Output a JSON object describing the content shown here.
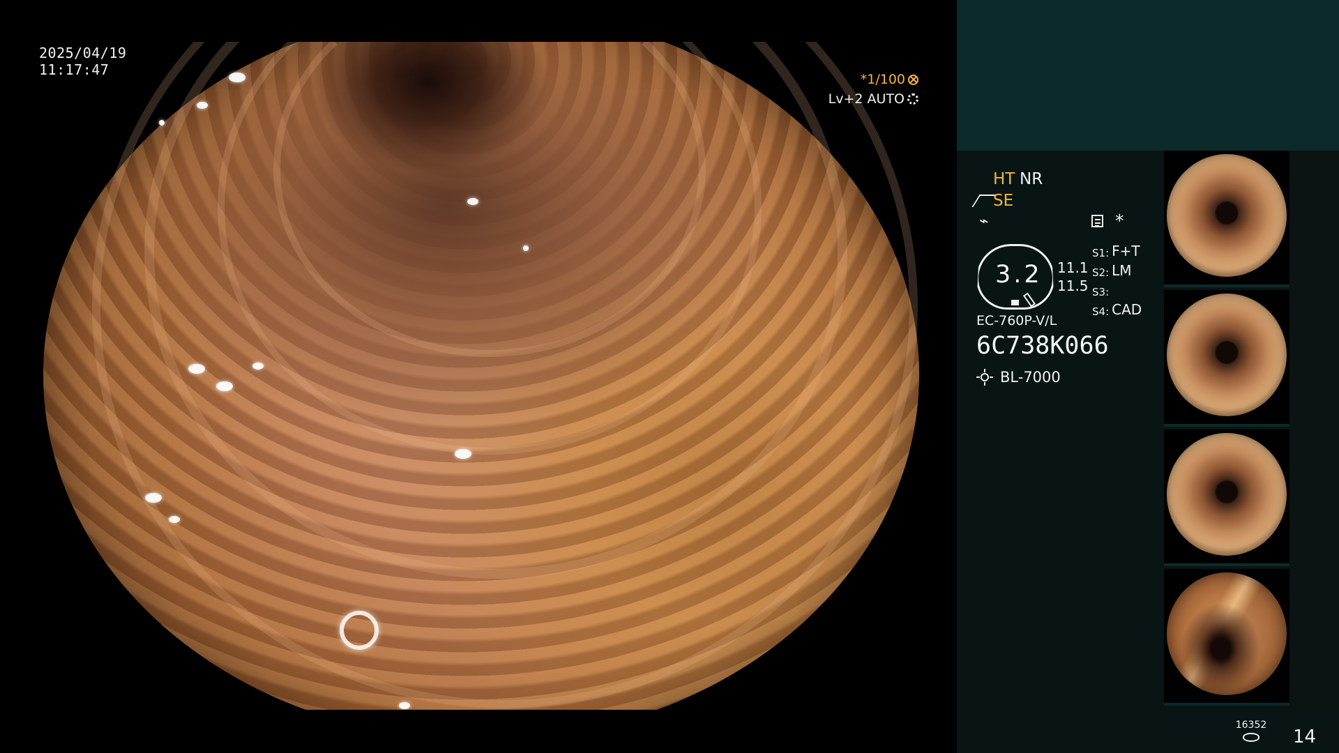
{
  "overlay": {
    "date": "2025/04/19",
    "time": "11:17:47",
    "shutter": "*1/100",
    "level": "Lv+2 AUTO"
  },
  "side_panel": {
    "mode_ht": "HT",
    "mode_nr": "NR",
    "mode_se": "SE",
    "asterisk": "*",
    "dial_value": "3.2",
    "dimensions": [
      "11.1",
      "11.5"
    ],
    "slots": [
      {
        "key": "S1:",
        "value": "F+T"
      },
      {
        "key": "S2:",
        "value": "LM"
      },
      {
        "key": "S3:",
        "value": ""
      },
      {
        "key": "S4:",
        "value": "CAD"
      }
    ],
    "scope_model": "EC-760P-V/L",
    "scope_serial": "6C738K066",
    "light_source": "BL-7000",
    "storage_count": "16352",
    "image_count": "14"
  },
  "icons": {
    "shutter": "aperture-icon",
    "level": "gear-icon",
    "branch": "branch-icon",
    "curve": "curve-icon",
    "memo": "memo-icon",
    "light": "light-bulb-icon",
    "storage": "disk-stack-icon"
  },
  "colors": {
    "accent": "#f6b63d",
    "panel": "#0d2a2a",
    "sidebar": "#091515",
    "text": "#f2f2f2"
  }
}
